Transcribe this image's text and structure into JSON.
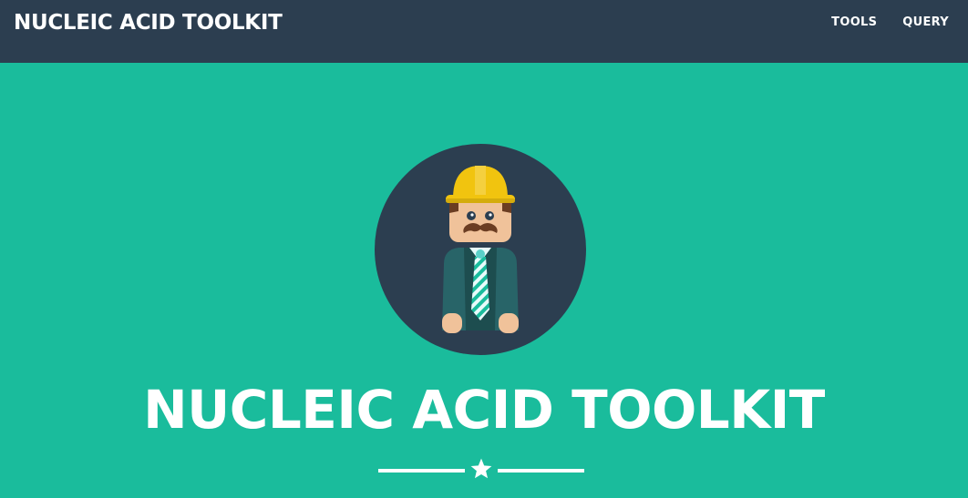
{
  "navbar": {
    "brand": "NUCLEIC ACID TOOLKIT",
    "links": [
      {
        "label": "TOOLS"
      },
      {
        "label": "QUERY"
      }
    ]
  },
  "hero": {
    "title": "NUCLEIC ACID TOOLKIT",
    "avatar_icon": "construction-worker-avatar-icon",
    "divider_icon": "star-icon"
  },
  "colors": {
    "navbar_bg": "#2c3e50",
    "hero_bg": "#1abc9c",
    "text": "#ffffff",
    "helmet": "#f1c40f",
    "jacket": "#286468",
    "tie": "#c9f1f1"
  }
}
